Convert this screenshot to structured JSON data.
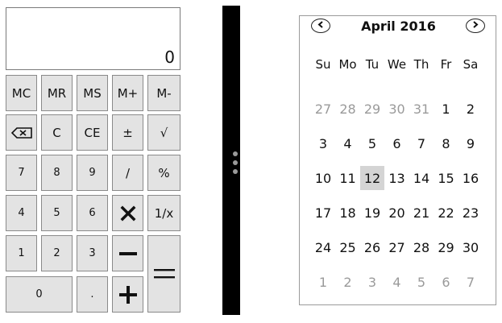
{
  "calculator": {
    "display": "0",
    "keys": {
      "mc": "MC",
      "mr": "MR",
      "ms": "MS",
      "mplus": "M+",
      "mminus": "M-",
      "c": "C",
      "ce": "CE",
      "plusminus": "±",
      "sqrt": "√",
      "seven": "7",
      "eight": "8",
      "nine": "9",
      "divide": "/",
      "percent": "%",
      "four": "4",
      "five": "5",
      "six": "6",
      "reciprocal": "1/x",
      "one": "1",
      "two": "2",
      "three": "3",
      "zero": "0",
      "decimal": "."
    }
  },
  "calendar": {
    "title": "April 2016",
    "prev_icon": "chevron-left-icon",
    "next_icon": "chevron-right-icon",
    "weekdays": [
      "Su",
      "Mo",
      "Tu",
      "We",
      "Th",
      "Fr",
      "Sa"
    ],
    "weeks": [
      [
        "27",
        "28",
        "29",
        "30",
        "31",
        "1",
        "2"
      ],
      [
        "3",
        "4",
        "5",
        "6",
        "7",
        "8",
        "9"
      ],
      [
        "10",
        "11",
        "12",
        "13",
        "14",
        "15",
        "16"
      ],
      [
        "17",
        "18",
        "19",
        "20",
        "21",
        "22",
        "23"
      ],
      [
        "24",
        "25",
        "26",
        "27",
        "28",
        "29",
        "30"
      ],
      [
        "1",
        "2",
        "3",
        "4",
        "5",
        "6",
        "7"
      ]
    ],
    "selected_day": "12",
    "muted_color": "#9a9a9a",
    "selected_color": "#d4d4d4"
  }
}
